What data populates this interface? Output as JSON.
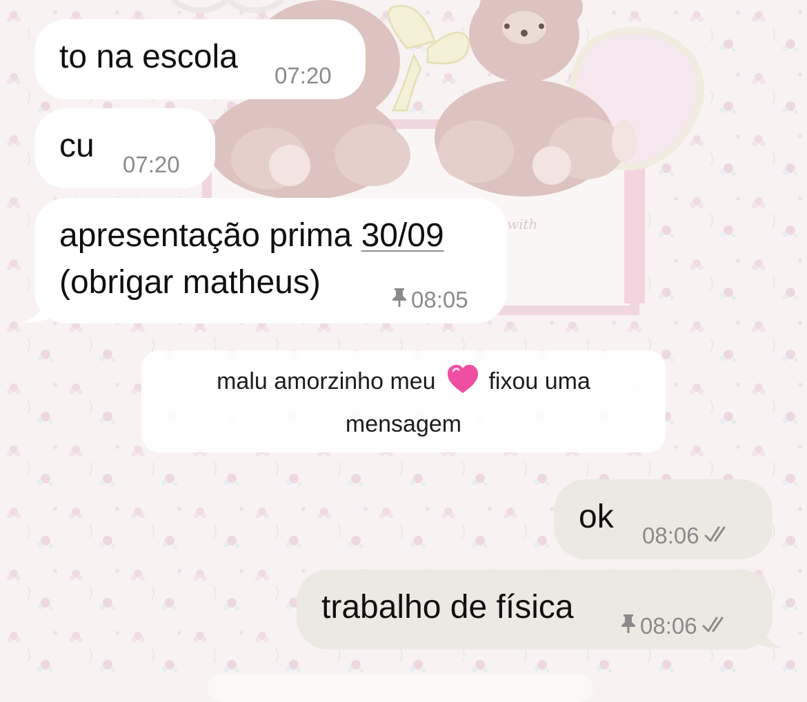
{
  "messages": [
    {
      "direction": "incoming",
      "text": "to na escola",
      "time": "07:20",
      "pinned": false
    },
    {
      "direction": "incoming",
      "text": "cu",
      "time": "07:20",
      "pinned": false
    },
    {
      "direction": "incoming",
      "line1_before_link": "apresentação prima ",
      "line1_link": "30/09",
      "line2": "(obrigar matheus)",
      "time": "08:05",
      "pinned": true,
      "pin_icon": "pin-icon"
    },
    {
      "direction": "outgoing",
      "text": "ok",
      "time": "08:06",
      "status_icon": "double-check-icon"
    },
    {
      "direction": "outgoing",
      "text": "trabalho de física",
      "time": "08:06",
      "pinned": true,
      "pin_icon": "pin-icon",
      "status_icon": "double-check-icon"
    }
  ],
  "system_note": {
    "before_emoji": "malu amorzinho meu ",
    "emoji": "pink-heart-icon",
    "after_emoji": " fixou uma",
    "line2": "mensagem"
  },
  "colors": {
    "incoming_bubble": "#ffffff",
    "outgoing_bubble": "#ece9e3",
    "meta_text": "#8a8a8a",
    "heart": "#ee4fa0",
    "wallpaper_pink": "#f3dfe6"
  }
}
